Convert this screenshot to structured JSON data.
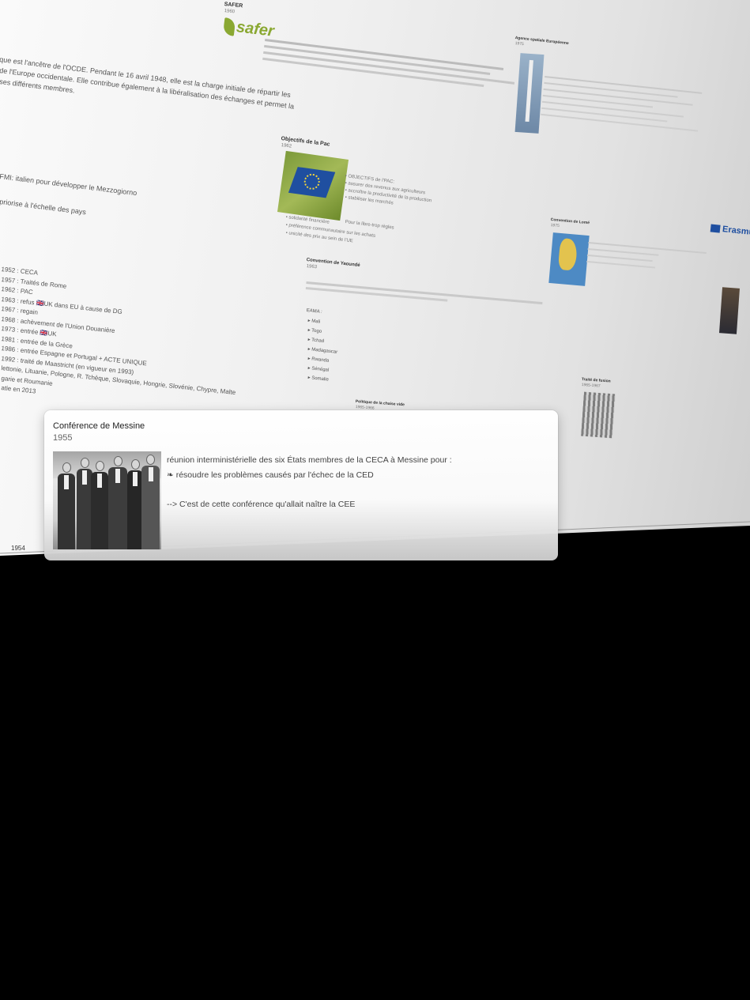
{
  "background": {
    "safer_header": "SAFER",
    "safer_year": "1960",
    "safer_logo_text": "safer",
    "left_column": [
      "que est l'ancêtre de l'OCDE. Pendant le 16 avril 1948, elle est la charge initiale de répartir les",
      "de l'Europe occidentale. Elle contribue également à la libéralisation des échanges et permet la",
      "ses différents membres."
    ],
    "left_mid": [
      "FMI: italien pour développer le Mezzogiorno",
      "priorise à l'échelle des pays"
    ],
    "dates_list": [
      "1952 : CECA",
      "1957 : Traités de Rome",
      "1962 : PAC",
      "1963 : refus 🇬🇧UK dans EU à cause de DG",
      "1967 : regain",
      "1968 : achèvement de l'Union Douanière",
      "1973 : entrée 🇬🇧UK",
      "1981 : entrée de la Grèce",
      "1986 : entrée Espagne et Portugal + ACTE UNIQUE",
      "1992 : traité de Maastricht (en vigueur en 1993)",
      "lettonie, Lituanie, Pologne, R. Tchèque, Slovaquie,   Hongrie, Slovénie, Chypre, Malte",
      "garie et Roumanie",
      "atie en 2013"
    ],
    "objectifs_title": "Objectifs de la Pac",
    "objectifs_year": "1962",
    "objectifs_items": [
      "OBJECTIFS de l'PAC:",
      "assurer des revenus aux agriculteurs",
      "accroître la productivité de la production",
      "stabiliser les marchés"
    ],
    "objectifs_footer": "Pour la libre-trop règles",
    "principes": [
      "solidarité financière",
      "préférence communautaire sur les achats",
      "unicité des prix au sein de l'UE"
    ],
    "yaounde_title": "Convention de Yaoundé",
    "yaounde_year": "1963",
    "yaounde_countries_label": "EAMA :",
    "yaounde_countries": [
      "Mali",
      "Togo",
      "Tchad",
      "Madagascar",
      "Rwanda",
      "Sénégal",
      "Somalie"
    ],
    "politique_title": "Politique de la chaise vide",
    "politique_year": "1965-1966",
    "ariane_title": "Agence spatiale Européenne",
    "ariane_year": "1975",
    "lome_title": "Convention de Lomé",
    "lome_year": "1975",
    "fusion_title": "Traité de fusion",
    "fusion_year": "1965-1967",
    "erasmus_logo_text": "Erasmus+",
    "axis_year": "1954"
  },
  "popup": {
    "title": "Conférence de Messine",
    "year": "1955",
    "photo_alt": "photo-des-ministres-a-messine",
    "lines": [
      "réunion interministérielle des six États membres de la CECA à Messine pour :",
      "❧ résoudre les problèmes causés par l'échec de la CED",
      "",
      "--> C'est de cette conférence qu'allait naître la CEE"
    ]
  }
}
